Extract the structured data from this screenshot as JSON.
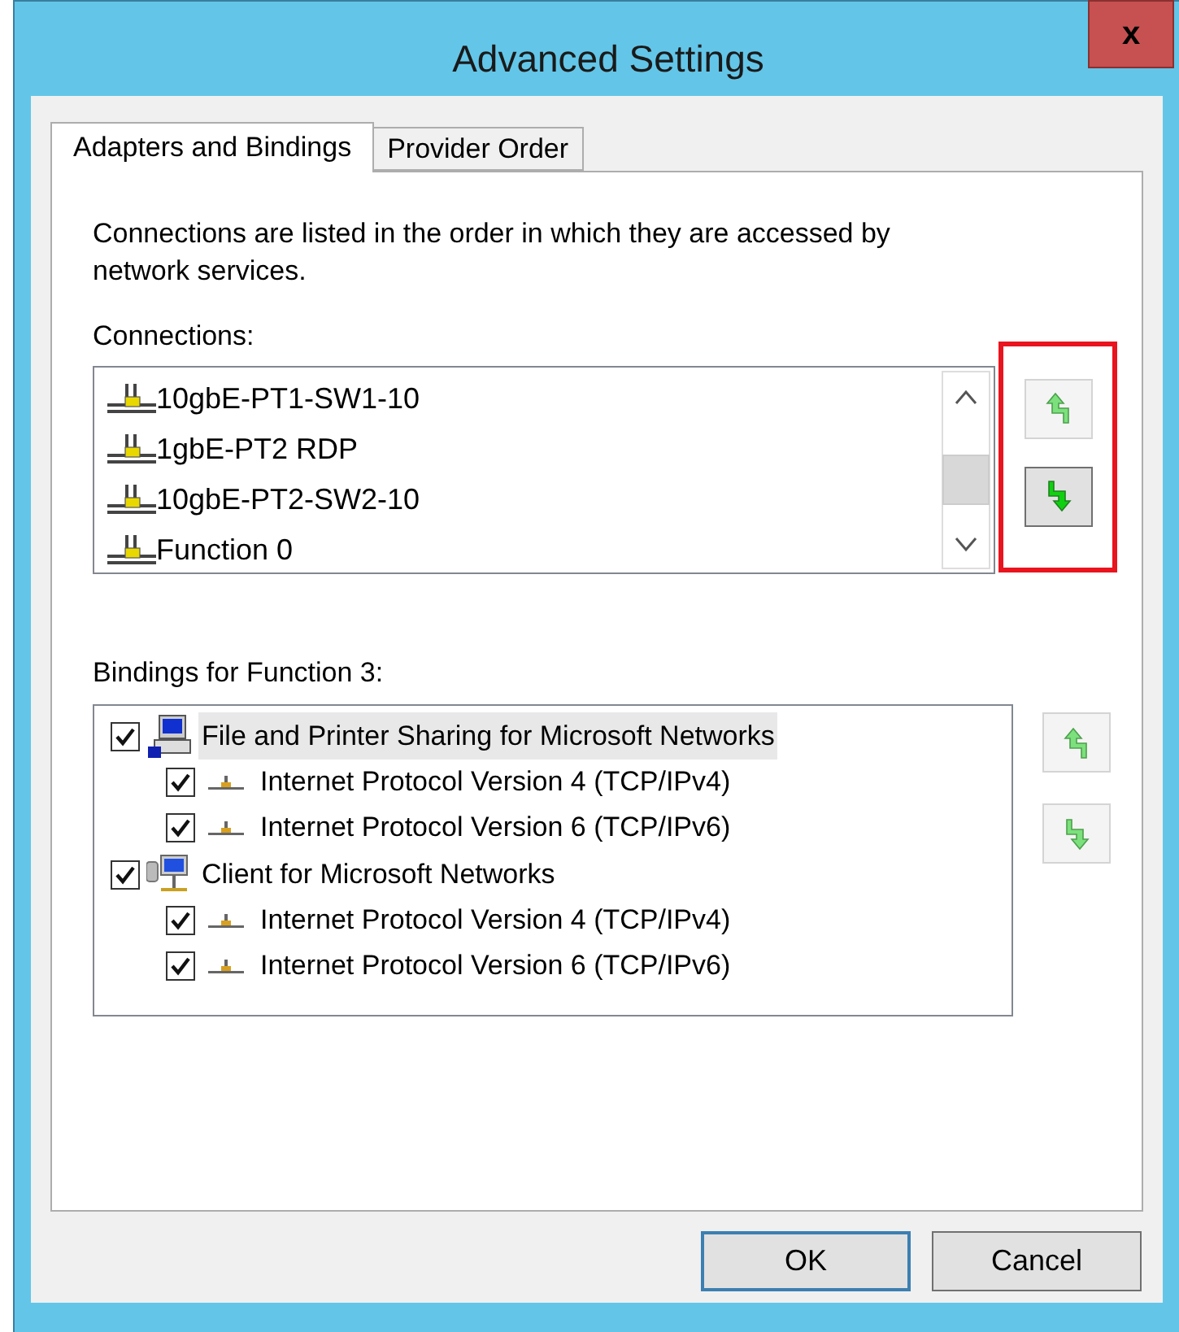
{
  "window": {
    "title": "Advanced Settings",
    "close": "x"
  },
  "tabs": [
    {
      "label": "Adapters and Bindings",
      "selected": true
    },
    {
      "label": "Provider Order",
      "selected": false
    }
  ],
  "description": "Connections are listed in the order in which they are accessed by network services.",
  "connections": {
    "label": "Connections:",
    "highlighted": true,
    "items": [
      {
        "name": "10gbE-PT1-SW1-10"
      },
      {
        "name": "1gbE-PT2 RDP"
      },
      {
        "name": "10gbE-PT2-SW2-10"
      },
      {
        "name": "Function 0"
      }
    ],
    "move_up": {
      "disabled": true
    },
    "move_down": {
      "disabled": false
    }
  },
  "bindings": {
    "label": "Bindings for Function 3:",
    "items": [
      {
        "kind": "service",
        "name": "File and Printer Sharing for Microsoft Networks",
        "checked": true,
        "selected": true,
        "children": [
          {
            "name": "Internet Protocol Version 4 (TCP/IPv4)",
            "checked": true,
            "selected": false
          },
          {
            "name": "Internet Protocol Version 6 (TCP/IPv6)",
            "checked": true,
            "selected": false
          }
        ]
      },
      {
        "kind": "client",
        "name": "Client for Microsoft Networks",
        "checked": true,
        "selected": false,
        "children": [
          {
            "name": "Internet Protocol Version 4 (TCP/IPv4)",
            "checked": true,
            "selected": false
          },
          {
            "name": "Internet Protocol Version 6 (TCP/IPv6)",
            "checked": true,
            "selected": false
          }
        ]
      }
    ],
    "move_up": {
      "disabled": true
    },
    "move_down": {
      "disabled": true
    }
  },
  "buttons": [
    {
      "label": "OK",
      "default": true
    },
    {
      "label": "Cancel",
      "default": false
    }
  ]
}
